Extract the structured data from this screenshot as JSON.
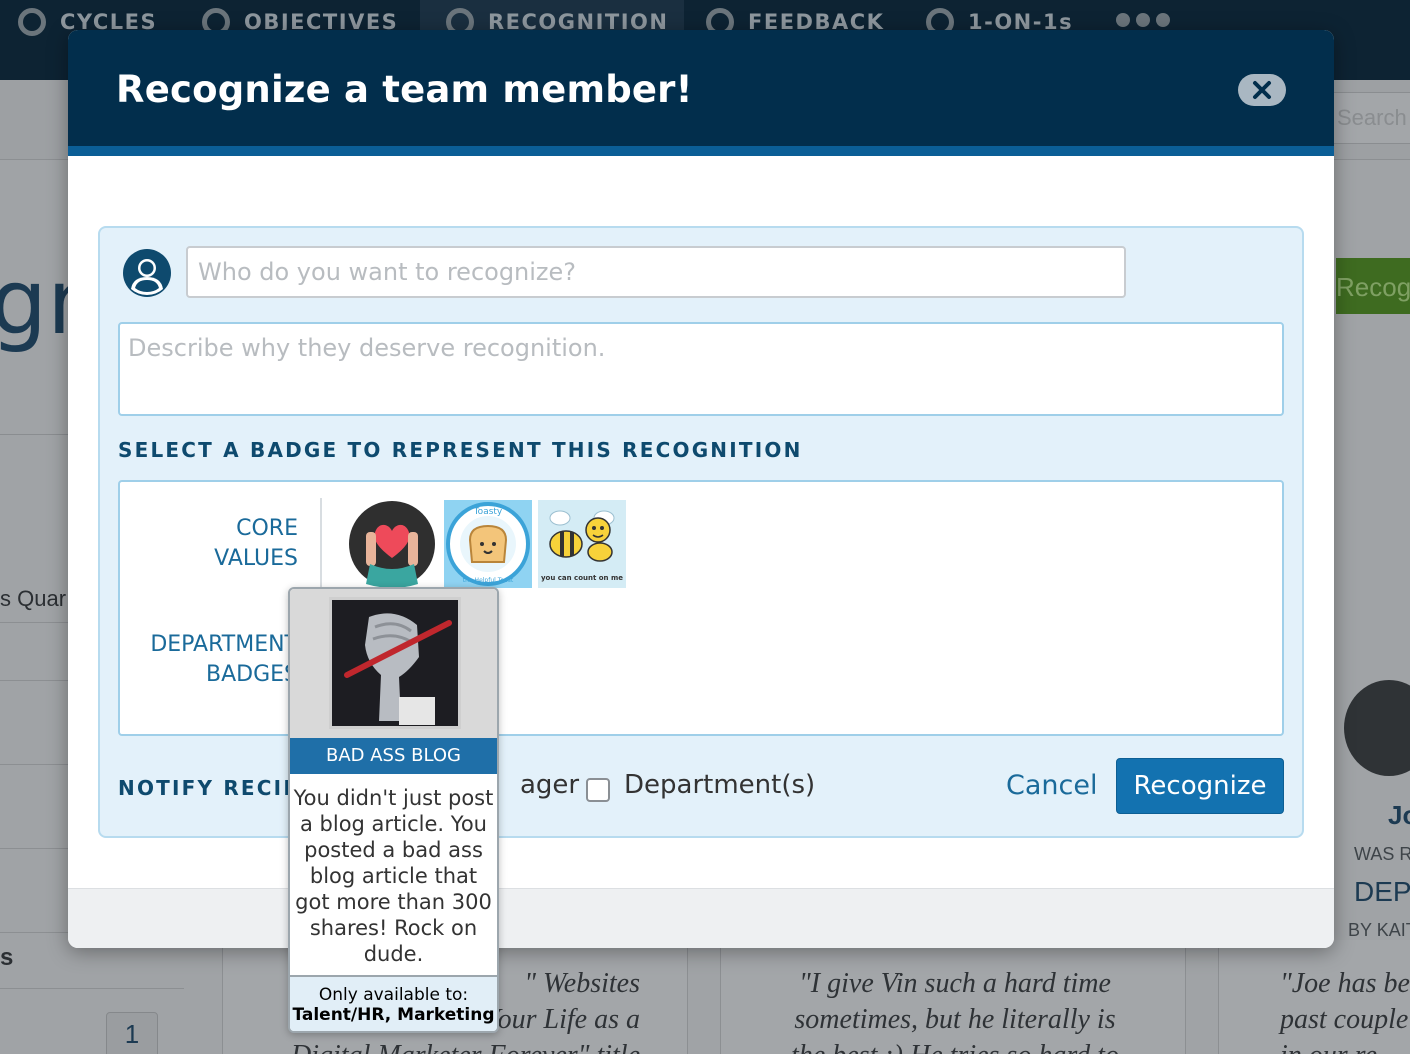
{
  "nav": {
    "items": [
      "CYCLES",
      "OBJECTIVES",
      "RECOGNITION",
      "FEEDBACK",
      "1-ON-1s"
    ]
  },
  "background": {
    "search_placeholder": "Search pe",
    "page_title_fragment": "gni",
    "recognize_btn_fragment": "Recogr",
    "left_quarter_text": "s Quar",
    "left_section_fragment": "s",
    "page_number": "1",
    "quote_left": "\" Websites\nYour Life as a\nDigital Marketer Forever\" title",
    "quote_middle": "\"I give Vin such a hard time\nsometimes, but he literally is\nthe best :) He tries so hard to",
    "quote_right": "\"Joe has bee\npast couple\nin our re",
    "right_name_fragment": "Jo",
    "right_was_fragment": "WAS R",
    "right_dept_fragment": "DEPE",
    "right_by_fragment": "BY KAIT"
  },
  "modal": {
    "title": "Recognize a team member!",
    "who_placeholder": "Who do you want to recognize?",
    "description_placeholder": "Describe why they deserve recognition.",
    "badge_section_label": "SELECT A BADGE TO REPRESENT THIS RECOGNITION",
    "badge_categories": [
      {
        "label_line1": "CORE",
        "label_line2": "VALUES"
      },
      {
        "label_line1": "DEPARTMENT",
        "label_line2": "BADGES"
      }
    ],
    "core_badges": [
      {
        "name": "heart-hands"
      },
      {
        "name": "Toasty the Helpful Toast",
        "ring_text_top": "Toasty",
        "ring_text_bottom": "the Helpful Toast"
      },
      {
        "name": "You can count on me",
        "caption": "you can count on me"
      }
    ],
    "notify_label": "NOTIFY RECIPI",
    "notify_options": [
      {
        "label": "ager",
        "checked": false
      },
      {
        "label": "Department(s)",
        "checked": false
      }
    ],
    "cancel_label": "Cancel",
    "recognize_label": "Recognize"
  },
  "tooltip": {
    "badge_name": "BAD ASS BLOG",
    "description": "You didn't just post a blog article. You posted a bad ass blog article that got more than 300 shares! Rock on dude.",
    "availability_label": "Only available to:",
    "availability_value": "Talent/HR, Marketing"
  },
  "colors": {
    "header": "#022e4c",
    "accent": "#1372b0",
    "panel_bg": "#e3f1fa",
    "label": "#0e4a6e"
  }
}
